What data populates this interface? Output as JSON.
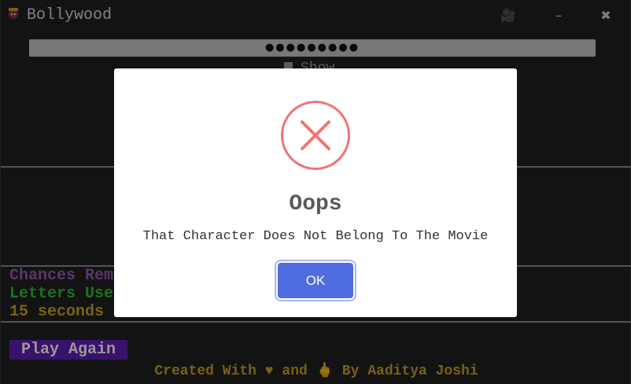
{
  "app": {
    "title": "Bollywood",
    "icon": "clapper-face-icon",
    "window_buttons": {
      "camera": "🎥",
      "minimize": "–",
      "close": "✖"
    }
  },
  "password": {
    "masked_value": "●●●●●●●●●",
    "show_label": "Show"
  },
  "stats": {
    "chances": "Chances Rema",
    "letters": "Letters Use",
    "timer": "15 seconds"
  },
  "play_again_label": "Play Again",
  "credits": "Created With ♥ and 🖕 By Aaditya Joshi",
  "modal": {
    "icon": "error-x-icon",
    "title": "Oops",
    "message": "That Character Does Not Belong To The Movie",
    "ok_label": "OK"
  },
  "colors": {
    "chances": "#9b59b6",
    "letters": "#2fbf2f",
    "timer": "#c9a227",
    "play_button": "#5e1fb4",
    "ok_button": "#4f6ce0",
    "error": "#f27474"
  }
}
